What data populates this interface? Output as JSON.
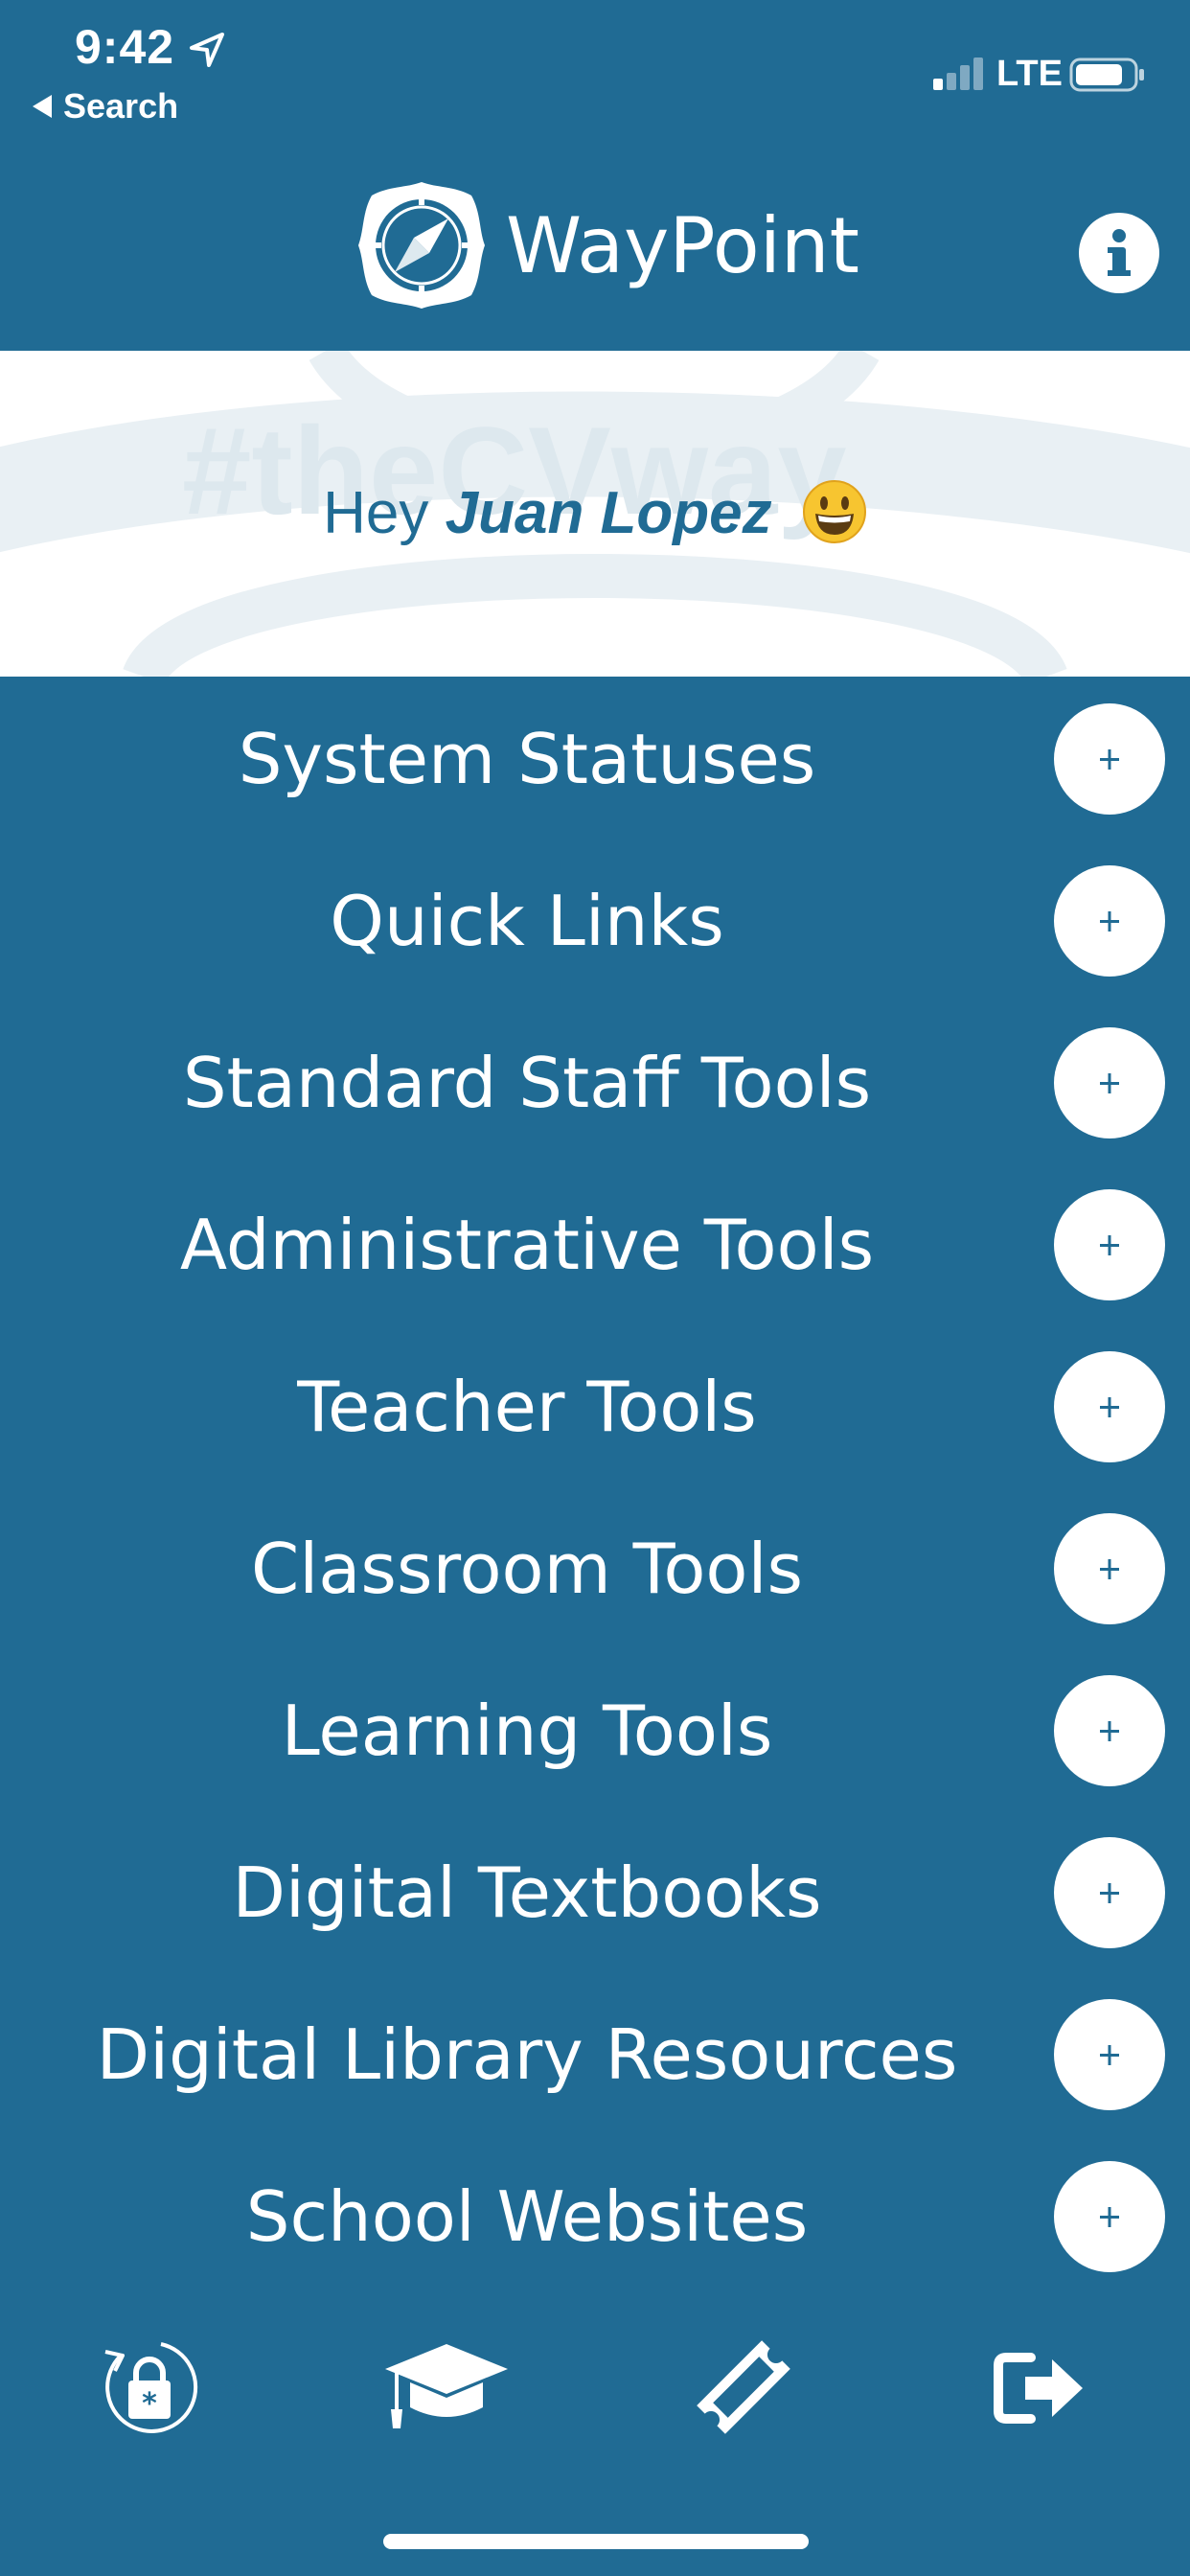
{
  "status_bar": {
    "time": "9:42",
    "back_label": "Search",
    "network": "LTE"
  },
  "header": {
    "app_title": "WayPoint",
    "logo_icon": "compass-icon",
    "info_icon": "info-icon"
  },
  "greeting": {
    "prefix": "Hey",
    "name": "Juan Lopez",
    "emoji_icon": "smiley-icon",
    "watermark_text": "#theCVway"
  },
  "menu": {
    "items": [
      {
        "label": "System Statuses"
      },
      {
        "label": "Quick Links"
      },
      {
        "label": "Standard Staff Tools"
      },
      {
        "label": "Administrative Tools"
      },
      {
        "label": "Teacher Tools"
      },
      {
        "label": "Classroom Tools"
      },
      {
        "label": "Learning Tools"
      },
      {
        "label": "Digital Textbooks"
      },
      {
        "label": "Digital Library Resources"
      },
      {
        "label": "School Websites"
      }
    ],
    "expand_icon": "plus-icon"
  },
  "tab_bar": {
    "tabs": [
      {
        "icon": "password-reset-icon"
      },
      {
        "icon": "graduation-cap-icon"
      },
      {
        "icon": "ticket-icon"
      },
      {
        "icon": "sign-out-icon"
      }
    ]
  },
  "colors": {
    "primary": "#206b94",
    "background_panel": "#ffffff",
    "watermark": "#dde8ee",
    "text_light": "#ffffff"
  }
}
